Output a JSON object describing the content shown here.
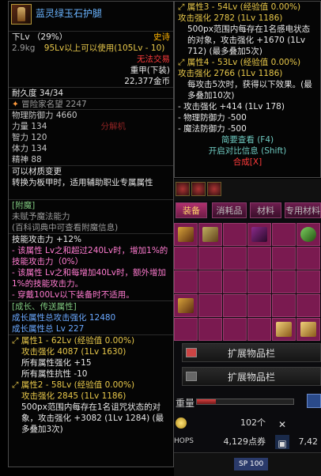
{
  "item": {
    "name": "蓝灵绿玉石护腿",
    "slot_line": "下Lv （29%）",
    "rarity": "史诗",
    "weight_line": "2.9kg",
    "level_req": "95Lv以上可以使用(105Lv - 10)",
    "untradeable": "无法交易",
    "heavy": "重甲(下装)",
    "price": "22,377金币",
    "durability": "耐久度 34/34",
    "adventurer": "冒险家名望 2247",
    "stats": [
      "物理防御力 4660",
      "力量 134",
      "智力 120",
      "体力 134",
      "精神 88"
    ],
    "decompose_hint": "分解机",
    "material_change": "可以材质变更",
    "convert_note": "转换为板甲时，适用辅助职业专属属性",
    "enchant_title": "[附魔]",
    "enchant_none": "未赋予魔法能力",
    "enchant_hint": "(百科词典中可查看附魔信息)",
    "skill_title": "技能攻击力 +12%",
    "skill_lines": [
      "- 该属性 Lv之和超过240Lv时，增加1%的技能攻击力（0%）",
      "- 该属性 Lv之和每增加40Lv时，额外增加1%的技能攻击力。",
      "- 穿戴100Lv以下装备时不适用。"
    ],
    "growth_title": "[成长、传送属性]",
    "growth_atk": "成长属性总攻击强化 12480",
    "growth_lv": "成长属性总 Lv 227",
    "attr1_title": "属性1 - 62Lv (经验值 0.00%)",
    "attr1_lines": [
      "攻击强化 4087 (1Lv 1630)",
      "所有属性强化 +15",
      "所有属性抗性 -10"
    ],
    "attr2_title": "属性2 - 58Lv (经验值 0.00%)",
    "attr2_lines": [
      "攻击强化 2845 (1Lv 1186)",
      "500px范围内每存在1名诅咒状态的对象，攻击强化 +3082 (1Lv 1284) (最多叠加3次)"
    ]
  },
  "tip2": {
    "attr3_title": "属性3 - 54Lv (经验值 0.00%)",
    "attr3_lines": [
      "攻击强化 2782 (1Lv 1186)",
      "500px范围内每存在1名感电状态的对象，攻击强化 +1670 (1Lv 712) (最多叠加5次)"
    ],
    "attr4_title": "属性4 - 53Lv (经验值 0.00%)",
    "attr4_lines": [
      "攻击强化 2766 (1Lv 1186)",
      "每攻击5次时，获得以下效果。(最多叠加10次)",
      "- 攻击强化 +414 (1Lv 178)",
      "- 物理防御力 -500",
      "- 魔法防御力 -500"
    ],
    "brief_view": "简要查看 (F4)",
    "compare_open": "开启对比信息 (Shift)",
    "synth": "合成[X]"
  },
  "inventory": {
    "tabs": [
      "装备",
      "消耗品",
      "材料",
      "专用材料"
    ],
    "expand_1": "扩展物品栏",
    "expand_2": "扩展物品栏",
    "weight_label": "重量",
    "weight_fraction": 0.2,
    "gold_count": "102个",
    "points": "4,129点券",
    "gold_right": "7,42",
    "sp_label": "SP 100",
    "shop_label": "HOPS"
  },
  "colors": {
    "accent_magenta": "#7a1a50",
    "tab_active": "#b0306e",
    "name_blue": "#6ab4ff",
    "epic_gold": "#ffb400",
    "warn_red": "#ff3b3b"
  }
}
